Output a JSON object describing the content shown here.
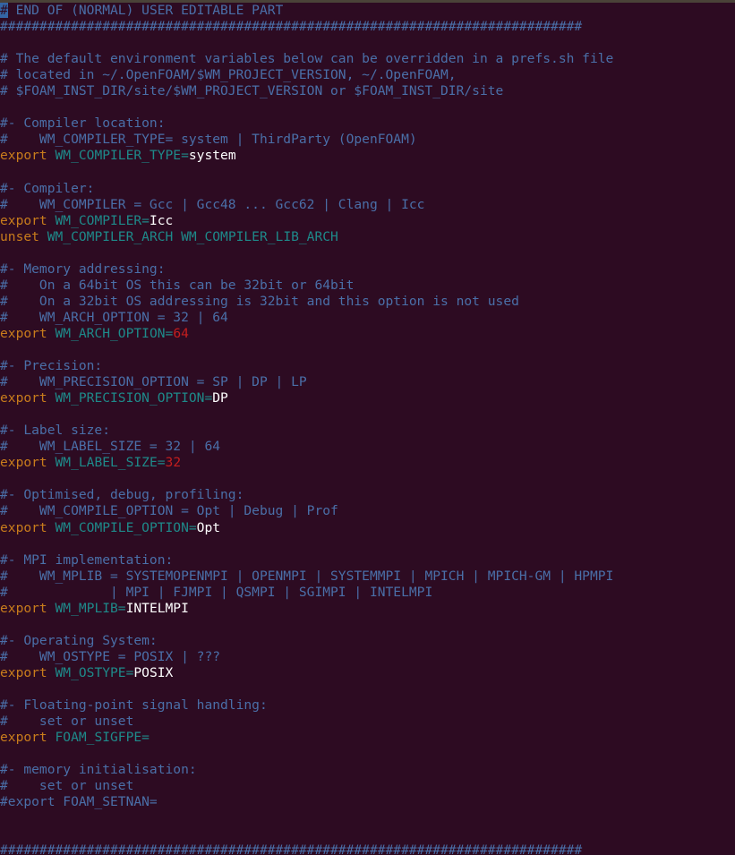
{
  "window": {
    "title": "OpenFOAM bashrc configuration",
    "background_color": "#2d0b22",
    "top_strip_color": "#4a4238"
  },
  "colors": {
    "comment": "#4a6fa8",
    "keyword": "#c87c1c",
    "variable": "#1e8a8a",
    "value": "#ffffff",
    "number": "#c41e1e",
    "cursor_background": "#3465a4"
  },
  "cursor": {
    "character": "#",
    "line": 1,
    "column": 1
  },
  "separator": {
    "hashes": "##########################################################################"
  },
  "lines": [
    {
      "id": "l1",
      "segments": [
        {
          "class": "cursor",
          "text": "#"
        },
        {
          "class": "cmt",
          "text": " END OF (NORMAL) USER EDITABLE PART"
        }
      ]
    },
    {
      "id": "l2",
      "segments": [
        {
          "class": "hashes",
          "text": "##########################################################################"
        }
      ]
    },
    {
      "id": "l3",
      "segments": []
    },
    {
      "id": "l4",
      "segments": [
        {
          "class": "cmt",
          "text": "# The default environment variables below can be overridden in a prefs.sh file"
        }
      ]
    },
    {
      "id": "l5",
      "segments": [
        {
          "class": "cmt",
          "text": "# located in ~/.OpenFOAM/$WM_PROJECT_VERSION, ~/.OpenFOAM,"
        }
      ]
    },
    {
      "id": "l6",
      "segments": [
        {
          "class": "cmt",
          "text": "# $FOAM_INST_DIR/site/$WM_PROJECT_VERSION or $FOAM_INST_DIR/site"
        }
      ]
    },
    {
      "id": "l7",
      "segments": []
    },
    {
      "id": "l8",
      "segments": [
        {
          "class": "cmt",
          "text": "#- Compiler location:"
        }
      ]
    },
    {
      "id": "l9",
      "segments": [
        {
          "class": "cmt",
          "text": "#    WM_COMPILER_TYPE= system | ThirdParty (OpenFOAM)"
        }
      ]
    },
    {
      "id": "l10",
      "segments": [
        {
          "class": "kw",
          "text": "export"
        },
        {
          "class": "plain",
          "text": " "
        },
        {
          "class": "var",
          "text": "WM_COMPILER_TYPE="
        },
        {
          "class": "val",
          "text": "system"
        }
      ]
    },
    {
      "id": "l11",
      "segments": []
    },
    {
      "id": "l12",
      "segments": [
        {
          "class": "cmt",
          "text": "#- Compiler:"
        }
      ]
    },
    {
      "id": "l13",
      "segments": [
        {
          "class": "cmt",
          "text": "#    WM_COMPILER = Gcc | Gcc48 ... Gcc62 | Clang | Icc"
        }
      ]
    },
    {
      "id": "l14",
      "segments": [
        {
          "class": "kw",
          "text": "export"
        },
        {
          "class": "plain",
          "text": " "
        },
        {
          "class": "var",
          "text": "WM_COMPILER="
        },
        {
          "class": "val",
          "text": "Icc"
        }
      ]
    },
    {
      "id": "l15",
      "segments": [
        {
          "class": "kw",
          "text": "unset"
        },
        {
          "class": "plain",
          "text": " "
        },
        {
          "class": "var",
          "text": "WM_COMPILER_ARCH WM_COMPILER_LIB_ARCH"
        }
      ]
    },
    {
      "id": "l16",
      "segments": []
    },
    {
      "id": "l17",
      "segments": [
        {
          "class": "cmt",
          "text": "#- Memory addressing:"
        }
      ]
    },
    {
      "id": "l18",
      "segments": [
        {
          "class": "cmt",
          "text": "#    On a 64bit OS this can be 32bit or 64bit"
        }
      ]
    },
    {
      "id": "l19",
      "segments": [
        {
          "class": "cmt",
          "text": "#    On a 32bit OS addressing is 32bit and this option is not used"
        }
      ]
    },
    {
      "id": "l20",
      "segments": [
        {
          "class": "cmt",
          "text": "#    WM_ARCH_OPTION = 32 | 64"
        }
      ]
    },
    {
      "id": "l21",
      "segments": [
        {
          "class": "kw",
          "text": "export"
        },
        {
          "class": "plain",
          "text": " "
        },
        {
          "class": "var",
          "text": "WM_ARCH_OPTION="
        },
        {
          "class": "num",
          "text": "64"
        }
      ]
    },
    {
      "id": "l22",
      "segments": []
    },
    {
      "id": "l23",
      "segments": [
        {
          "class": "cmt",
          "text": "#- Precision:"
        }
      ]
    },
    {
      "id": "l24",
      "segments": [
        {
          "class": "cmt",
          "text": "#    WM_PRECISION_OPTION = SP | DP | LP"
        }
      ]
    },
    {
      "id": "l25",
      "segments": [
        {
          "class": "kw",
          "text": "export"
        },
        {
          "class": "plain",
          "text": " "
        },
        {
          "class": "var",
          "text": "WM_PRECISION_OPTION="
        },
        {
          "class": "val",
          "text": "DP"
        }
      ]
    },
    {
      "id": "l26",
      "segments": []
    },
    {
      "id": "l27",
      "segments": [
        {
          "class": "cmt",
          "text": "#- Label size:"
        }
      ]
    },
    {
      "id": "l28",
      "segments": [
        {
          "class": "cmt",
          "text": "#    WM_LABEL_SIZE = 32 | 64"
        }
      ]
    },
    {
      "id": "l29",
      "segments": [
        {
          "class": "kw",
          "text": "export"
        },
        {
          "class": "plain",
          "text": " "
        },
        {
          "class": "var",
          "text": "WM_LABEL_SIZE="
        },
        {
          "class": "num",
          "text": "32"
        }
      ]
    },
    {
      "id": "l30",
      "segments": []
    },
    {
      "id": "l31",
      "segments": [
        {
          "class": "cmt",
          "text": "#- Optimised, debug, profiling:"
        }
      ]
    },
    {
      "id": "l32",
      "segments": [
        {
          "class": "cmt",
          "text": "#    WM_COMPILE_OPTION = Opt | Debug | Prof"
        }
      ]
    },
    {
      "id": "l33",
      "segments": [
        {
          "class": "kw",
          "text": "export"
        },
        {
          "class": "plain",
          "text": " "
        },
        {
          "class": "var",
          "text": "WM_COMPILE_OPTION="
        },
        {
          "class": "val",
          "text": "Opt"
        }
      ]
    },
    {
      "id": "l34",
      "segments": []
    },
    {
      "id": "l35",
      "segments": [
        {
          "class": "cmt",
          "text": "#- MPI implementation:"
        }
      ]
    },
    {
      "id": "l36",
      "segments": [
        {
          "class": "cmt",
          "text": "#    WM_MPLIB = SYSTEMOPENMPI | OPENMPI | SYSTEMMPI | MPICH | MPICH-GM | HPMPI"
        }
      ]
    },
    {
      "id": "l37",
      "segments": [
        {
          "class": "cmt",
          "text": "#             | MPI | FJMPI | QSMPI | SGIMPI | INTELMPI"
        }
      ]
    },
    {
      "id": "l38",
      "segments": [
        {
          "class": "kw",
          "text": "export"
        },
        {
          "class": "plain",
          "text": " "
        },
        {
          "class": "var",
          "text": "WM_MPLIB="
        },
        {
          "class": "val",
          "text": "INTELMPI"
        }
      ]
    },
    {
      "id": "l39",
      "segments": []
    },
    {
      "id": "l40",
      "segments": [
        {
          "class": "cmt",
          "text": "#- Operating System:"
        }
      ]
    },
    {
      "id": "l41",
      "segments": [
        {
          "class": "cmt",
          "text": "#    WM_OSTYPE = POSIX | ???"
        }
      ]
    },
    {
      "id": "l42",
      "segments": [
        {
          "class": "kw",
          "text": "export"
        },
        {
          "class": "plain",
          "text": " "
        },
        {
          "class": "var",
          "text": "WM_OSTYPE="
        },
        {
          "class": "val",
          "text": "POSIX"
        }
      ]
    },
    {
      "id": "l43",
      "segments": []
    },
    {
      "id": "l44",
      "segments": [
        {
          "class": "cmt",
          "text": "#- Floating-point signal handling:"
        }
      ]
    },
    {
      "id": "l45",
      "segments": [
        {
          "class": "cmt",
          "text": "#    set or unset"
        }
      ]
    },
    {
      "id": "l46",
      "segments": [
        {
          "class": "kw",
          "text": "export"
        },
        {
          "class": "plain",
          "text": " "
        },
        {
          "class": "var",
          "text": "FOAM_SIGFPE="
        }
      ]
    },
    {
      "id": "l47",
      "segments": []
    },
    {
      "id": "l48",
      "segments": [
        {
          "class": "cmt",
          "text": "#- memory initialisation:"
        }
      ]
    },
    {
      "id": "l49",
      "segments": [
        {
          "class": "cmt",
          "text": "#    set or unset"
        }
      ]
    },
    {
      "id": "l50",
      "segments": [
        {
          "class": "cmt",
          "text": "#export FOAM_SETNAN="
        }
      ]
    },
    {
      "id": "l51",
      "segments": []
    },
    {
      "id": "l52",
      "segments": []
    },
    {
      "id": "l53",
      "segments": [
        {
          "class": "hashes",
          "text": "##########################################################################"
        }
      ]
    }
  ]
}
